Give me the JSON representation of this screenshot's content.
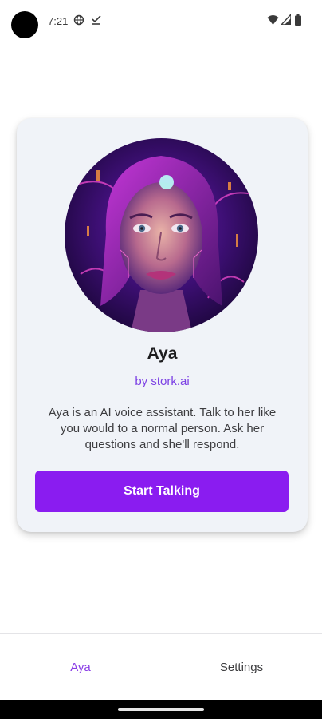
{
  "status_bar": {
    "time": "7:21",
    "icons": [
      "globe-icon",
      "check-icon",
      "wifi-icon",
      "signal-icon",
      "battery-icon"
    ]
  },
  "card": {
    "avatar_icon": "ai-woman-portrait",
    "name": "Aya",
    "byline": "by stork.ai",
    "description": "Aya is an AI voice assistant. Talk to her like you would to a normal person. Ask her questions and she'll respond.",
    "button_label": "Start Talking"
  },
  "bottom_nav": {
    "tabs": [
      {
        "label": "Aya",
        "active": true
      },
      {
        "label": "Settings",
        "active": false
      }
    ]
  },
  "colors": {
    "accent": "#8a1cf0",
    "active_tab": "#8a3de6",
    "card_bg": "#f0f3f8"
  }
}
